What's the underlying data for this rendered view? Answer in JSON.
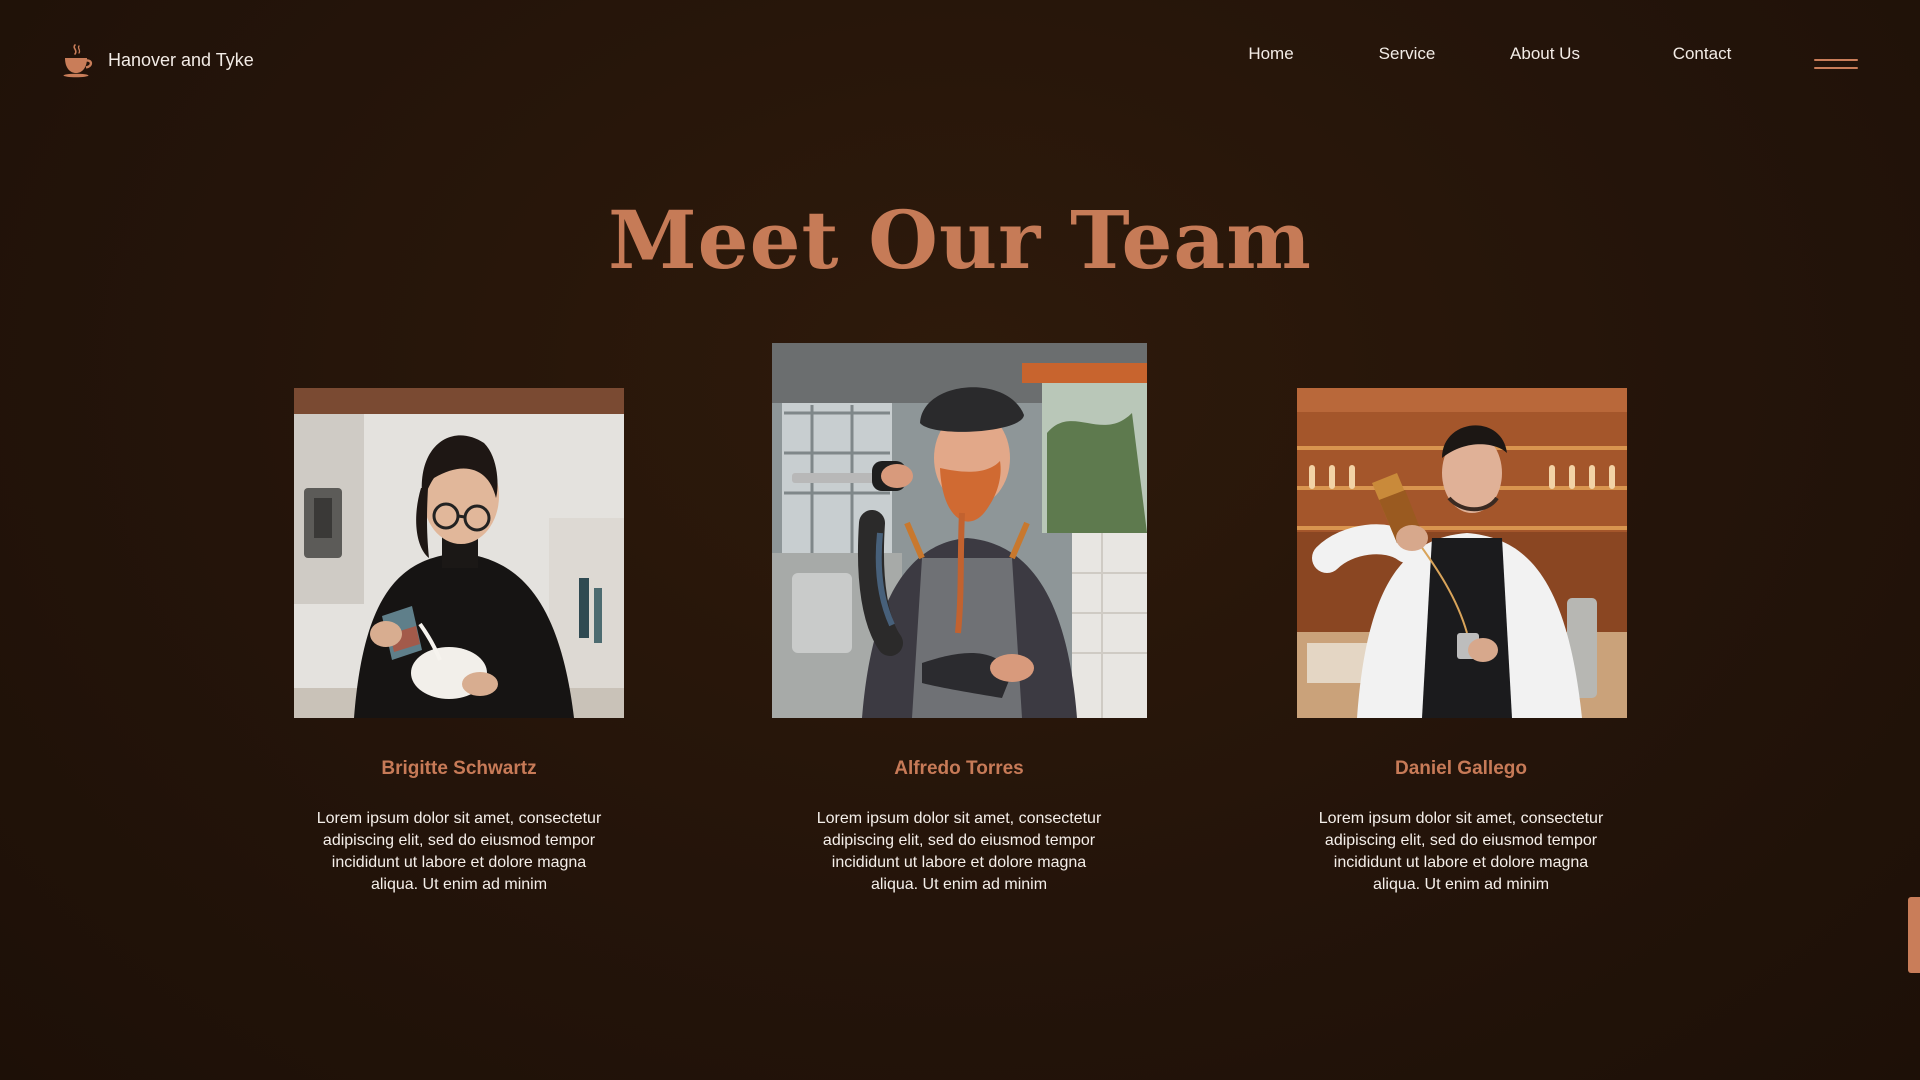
{
  "brand": {
    "name": "Hanover and Tyke",
    "icon": "coffee-cup-icon",
    "accent_color": "#c97d59"
  },
  "nav": {
    "items": [
      {
        "label": "Home"
      },
      {
        "label": "Service"
      },
      {
        "label": "About Us"
      },
      {
        "label": "Contact"
      }
    ],
    "menu_icon": "hamburger-menu-icon"
  },
  "page": {
    "title": "Meet Our Team",
    "title_color": "#c67b57",
    "background_color": "#24140a"
  },
  "team": [
    {
      "name": "Brigitte Schwartz",
      "photo": "barista-pouring-latte-art-photo",
      "bio": [
        "Lorem ipsum dolor sit amet, consectetur",
        "adipiscing elit, sed do eiusmod tempor",
        "incididunt ut labore et dolore magna",
        "aliqua. Ut enim ad minim"
      ]
    },
    {
      "name": "Alfredo Torres",
      "photo": "barista-with-portafilter-photo",
      "bio": [
        "Lorem ipsum dolor sit amet, consectetur",
        "adipiscing elit, sed do eiusmod tempor",
        "incididunt ut labore et dolore magna",
        "aliqua. Ut enim ad minim"
      ]
    },
    {
      "name": "Daniel Gallego",
      "photo": "bartender-pouring-drink-photo",
      "bio": [
        "Lorem ipsum dolor sit amet, consectetur",
        "adipiscing elit, sed do eiusmod tempor",
        "incididunt ut labore et dolore magna",
        "aliqua. Ut enim ad minim"
      ]
    }
  ]
}
